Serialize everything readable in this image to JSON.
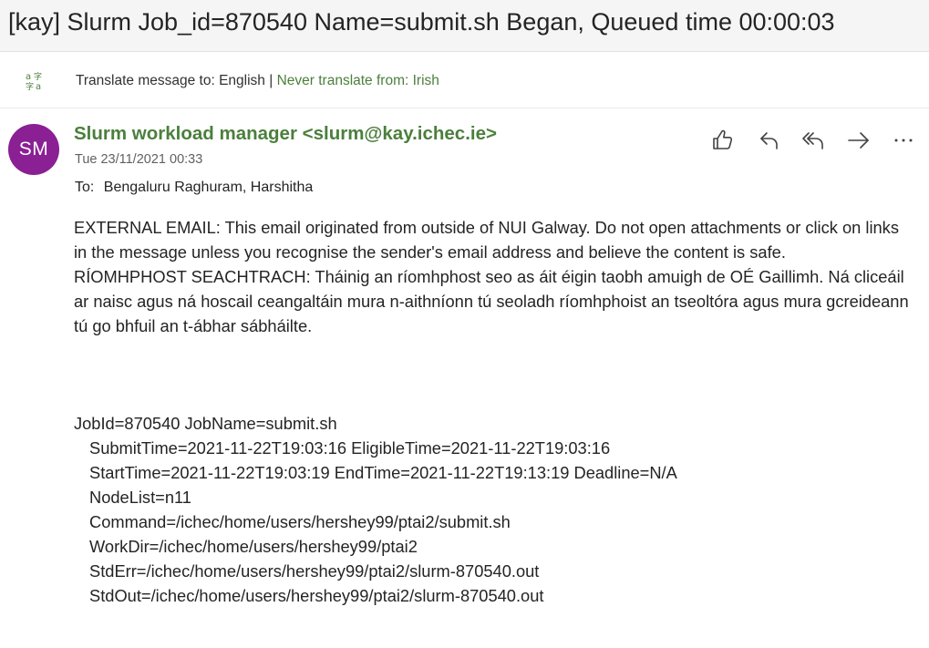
{
  "subject": "[kay] Slurm Job_id=870540 Name=submit.sh Began, Queued time 00:00:03",
  "translate": {
    "icon": "translate-icon",
    "prompt": "Translate message to: English",
    "separator": "|",
    "never_link": "Never translate from: Irish"
  },
  "message": {
    "avatar_initials": "SM",
    "avatar_color": "#8b1f94",
    "sender": "Slurm workload manager <slurm@kay.ichec.ie>",
    "date": "Tue 23/11/2021 00:33",
    "to_label": "To:",
    "to_value": "Bengaluru Raghuram, Harshitha",
    "actions": [
      {
        "icon": "like-icon",
        "name": "like-button"
      },
      {
        "icon": "reply-icon",
        "name": "reply-button"
      },
      {
        "icon": "reply-all-icon",
        "name": "reply-all-button"
      },
      {
        "icon": "forward-icon",
        "name": "forward-button"
      },
      {
        "icon": "more-icon",
        "name": "more-actions-button"
      }
    ],
    "body": {
      "external_en": "EXTERNAL EMAIL: This email originated from outside of NUI Galway. Do not open attachments or click on links in the message unless you recognise the sender's email address and believe the content is safe.",
      "external_ga": "RÍOMHPHOST SEACHTRACH: Tháinig an ríomhphost seo as áit éigin taobh amuigh de OÉ Gaillimh. Ná cliceáil ar naisc agus ná hoscail ceangaltáin mura n-aithníonn tú seoladh ríomhphoist an tseoltóra agus mura gcreideann tú go bhfuil an t-ábhar sábháilte.",
      "job_lines": [
        "JobId=870540 JobName=submit.sh",
        "SubmitTime=2021-11-22T19:03:16 EligibleTime=2021-11-22T19:03:16",
        "StartTime=2021-11-22T19:03:19 EndTime=2021-11-22T19:13:19 Deadline=N/A",
        "NodeList=n11",
        "Command=/ichec/home/users/hershey99/ptai2/submit.sh",
        "WorkDir=/ichec/home/users/hershey99/ptai2",
        "StdErr=/ichec/home/users/hershey99/ptai2/slurm-870540.out",
        "StdOut=/ichec/home/users/hershey99/ptai2/slurm-870540.out"
      ]
    }
  },
  "colors": {
    "link_green": "#4b7f3c",
    "icon_gray": "#424242"
  }
}
